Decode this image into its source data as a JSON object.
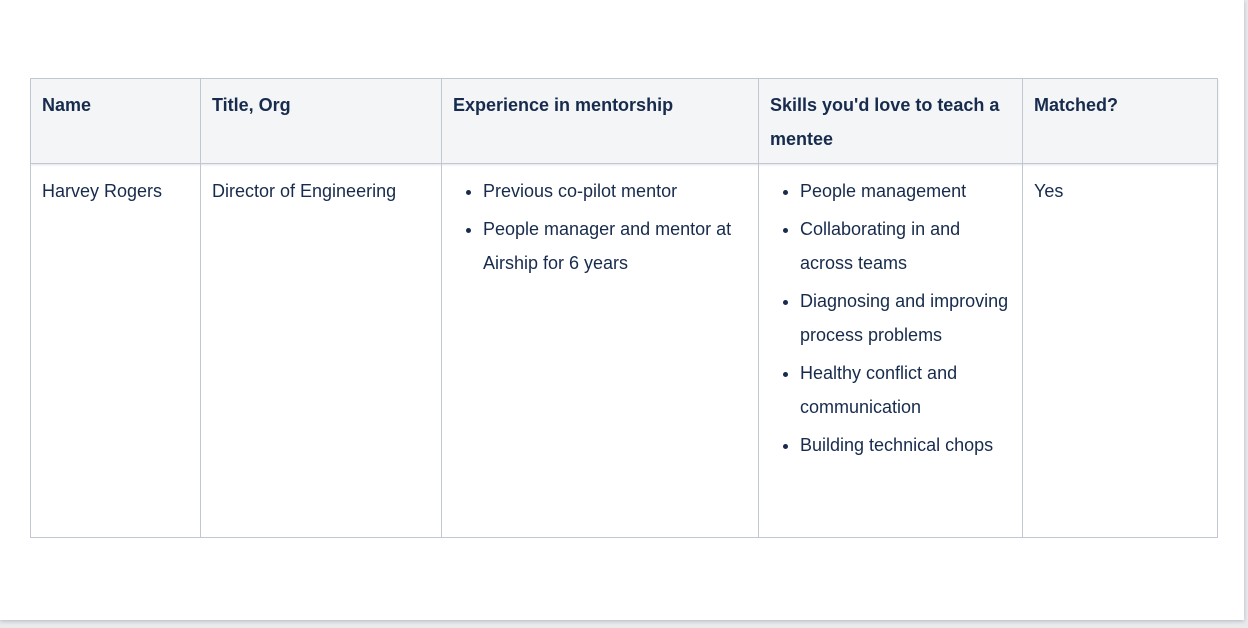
{
  "table": {
    "headers": {
      "name": "Name",
      "title_org": "Title, Org",
      "experience": "Experience in mentorship",
      "skills": "Skills you'd love to teach a mentee",
      "matched": "Matched?"
    },
    "rows": [
      {
        "name": "Harvey Rogers",
        "title_org": "Director of Engineering",
        "experience": [
          "Previous co-pilot mentor",
          "People manager and mentor at Airship for 6 years"
        ],
        "skills": [
          "People management",
          "Collaborating in and across teams",
          "Diagnosing and improving process problems",
          "Healthy conflict and communication",
          "Building technical chops"
        ],
        "matched": "Yes"
      }
    ]
  }
}
